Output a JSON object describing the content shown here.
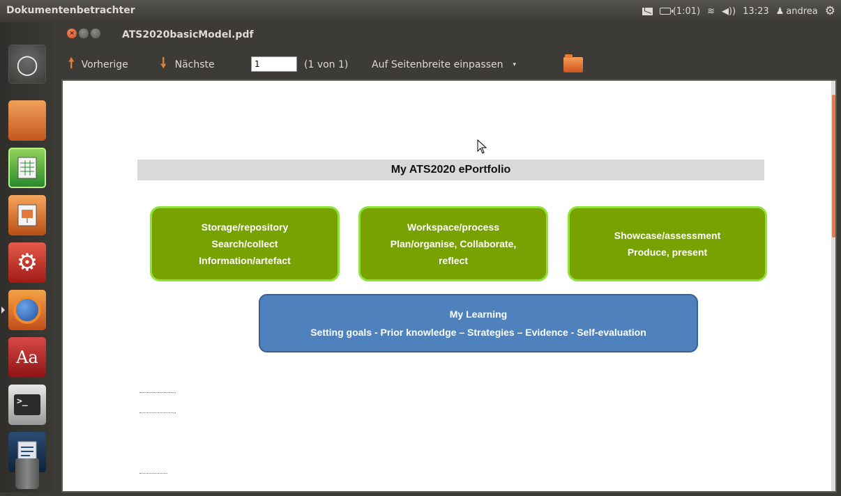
{
  "top_panel": {
    "app_name": "Dokumentenbetrachter",
    "battery_time": "(1:01)",
    "volume_label": "◀))",
    "clock": "13:23",
    "user": "andrea"
  },
  "launcher": {
    "items": [
      {
        "name": "dash-home",
        "icon": "ubuntu-logo-icon"
      },
      {
        "name": "files",
        "icon": "folder-icon"
      },
      {
        "name": "libreoffice-calc",
        "icon": "spreadsheet-icon"
      },
      {
        "name": "libreoffice-impress",
        "icon": "presentation-icon"
      },
      {
        "name": "system-settings",
        "icon": "settings-icon"
      },
      {
        "name": "firefox",
        "icon": "firefox-icon"
      },
      {
        "name": "font-viewer",
        "icon": "font-icon",
        "glyph": "Aa"
      },
      {
        "name": "terminal",
        "icon": "terminal-icon",
        "glyph": ">_"
      },
      {
        "name": "libreoffice-writer",
        "icon": "document-icon"
      },
      {
        "name": "trash",
        "icon": "trash-icon"
      }
    ]
  },
  "window": {
    "title": "ATS2020basicModel.pdf"
  },
  "toolbar": {
    "prev_label": "Vorherige",
    "next_label": "Nächste",
    "page_value": "1",
    "page_count": "(1 von 1)",
    "zoom_label": "Auf Seitenbreite einpassen",
    "dropdown_arrow": "▾"
  },
  "document": {
    "title": "My ATS2020 ePortfolio",
    "boxes": [
      {
        "lines": [
          "Storage/repository",
          "Search/collect",
          "Information/artefact"
        ]
      },
      {
        "lines": [
          "Workspace/process",
          "Plan/organise, Collaborate,",
          "reflect"
        ]
      },
      {
        "lines": [
          "Showcase/assessment",
          "Produce, present"
        ]
      }
    ],
    "learning": {
      "line1": "My Learning",
      "line2": "Setting goals - Prior knowledge – Strategies – Evidence  - Self-evaluation"
    }
  },
  "colors": {
    "green_box": "#77a200",
    "green_border": "#8ee23a",
    "blue_box": "#4f81bd",
    "accent_orange": "#f07746"
  }
}
